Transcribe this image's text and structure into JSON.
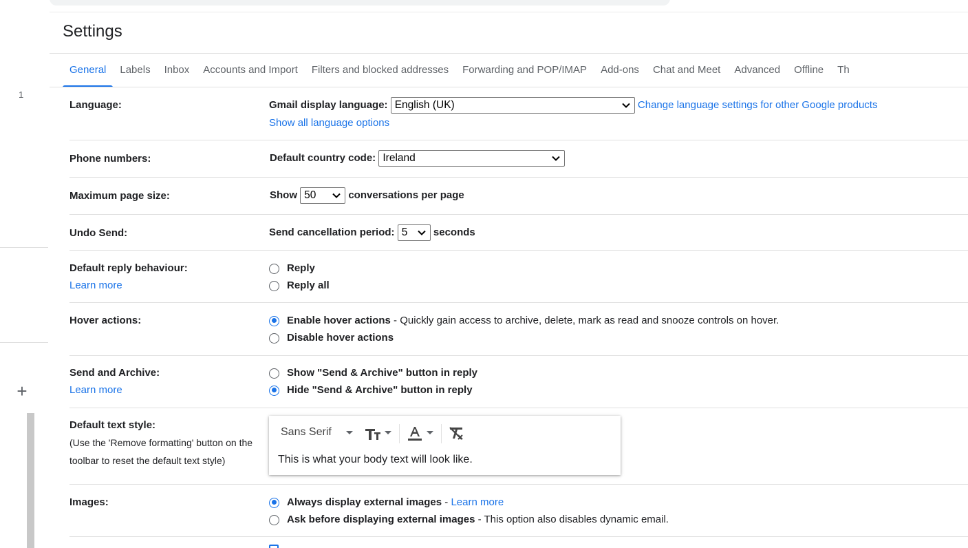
{
  "page_title": "Settings",
  "rail": {
    "count": "1"
  },
  "tabs": [
    {
      "label": "General"
    },
    {
      "label": "Labels"
    },
    {
      "label": "Inbox"
    },
    {
      "label": "Accounts and Import"
    },
    {
      "label": "Filters and blocked addresses"
    },
    {
      "label": "Forwarding and POP/IMAP"
    },
    {
      "label": "Add-ons"
    },
    {
      "label": "Chat and Meet"
    },
    {
      "label": "Advanced"
    },
    {
      "label": "Offline"
    },
    {
      "label": "Th"
    }
  ],
  "language": {
    "label": "Language:",
    "display_label": "Gmail display language:",
    "value": "English (UK)",
    "change_link": "Change language settings for other Google products",
    "show_all_link": "Show all language options"
  },
  "phone": {
    "label": "Phone numbers:",
    "country_label": "Default country code:",
    "value": "Ireland"
  },
  "page_size": {
    "label": "Maximum page size:",
    "prefix": "Show",
    "value": "50",
    "suffix": "conversations per page"
  },
  "undo_send": {
    "label": "Undo Send:",
    "period_label": "Send cancellation period:",
    "value": "5",
    "suffix": "seconds"
  },
  "reply": {
    "label": "Default reply behaviour:",
    "learn_more": "Learn more",
    "options": [
      {
        "label": "Reply",
        "selected": false
      },
      {
        "label": "Reply all",
        "selected": false
      }
    ]
  },
  "hover": {
    "label": "Hover actions:",
    "enable_label": "Enable hover actions",
    "enable_desc": " - Quickly gain access to archive, delete, mark as read and snooze controls on hover.",
    "disable_label": "Disable hover actions",
    "selected": "enable"
  },
  "send_archive": {
    "label": "Send and Archive:",
    "learn_more": "Learn more",
    "show_label": "Show \"Send & Archive\" button in reply",
    "hide_label": "Hide \"Send & Archive\" button in reply",
    "selected": "hide"
  },
  "text_style": {
    "label": "Default text style:",
    "hint": "(Use the 'Remove formatting' button on the toolbar to reset the default text style)",
    "font": "Sans Serif",
    "sample": "This is what your body text will look like."
  },
  "images": {
    "label": "Images:",
    "always_label": "Always display external images",
    "always_sep": " - ",
    "learn_more": "Learn more",
    "ask_label": "Ask before displaying external images",
    "ask_desc": " - This option also disables dynamic email.",
    "selected": "always"
  },
  "colors": {
    "accent": "#1a73e8",
    "text": "#202124",
    "muted": "#5f6368",
    "rule": "#e0e0e0"
  }
}
